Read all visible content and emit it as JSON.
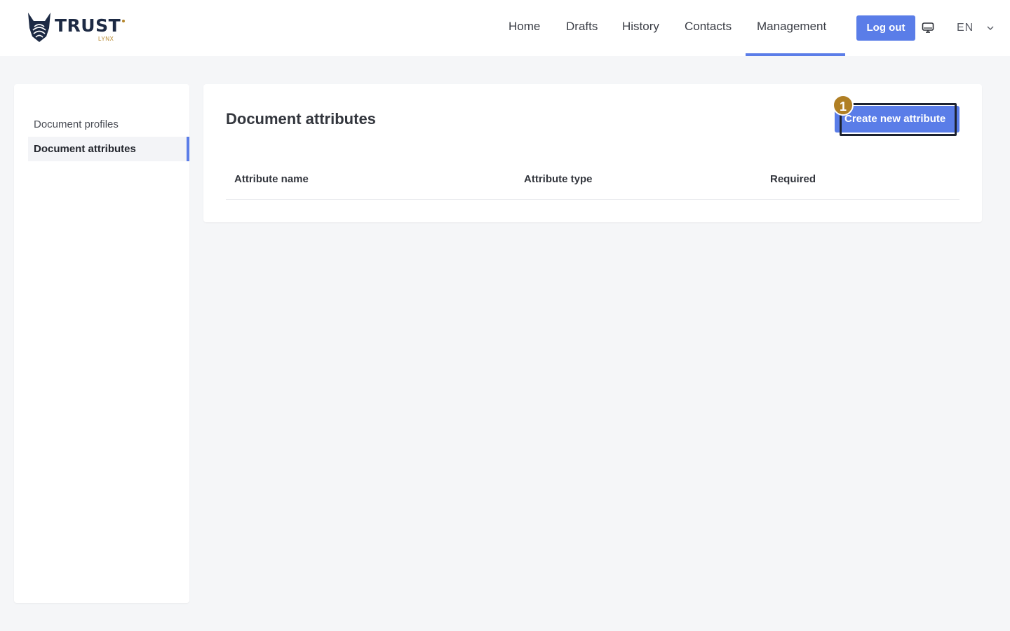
{
  "brand": {
    "name": "TRUST",
    "sub": "LYNX",
    "colors": {
      "primary": "#5a7de8",
      "navy": "#1d2a44",
      "gold": "#b5862b"
    }
  },
  "nav": {
    "items": [
      "Home",
      "Drafts",
      "History",
      "Contacts",
      "Management"
    ],
    "active": "Management",
    "logout_label": "Log out",
    "language": "EN"
  },
  "sidebar": {
    "items": [
      "Document profiles",
      "Document attributes"
    ],
    "active": "Document attributes"
  },
  "main": {
    "title": "Document attributes",
    "create_button": "Create new attribute",
    "step_badge": "1",
    "table": {
      "columns": [
        "Attribute name",
        "Attribute type",
        "Required"
      ],
      "rows": []
    }
  },
  "icons": {
    "display": "monitor-icon",
    "language_toggle": "chevron-down-icon"
  }
}
